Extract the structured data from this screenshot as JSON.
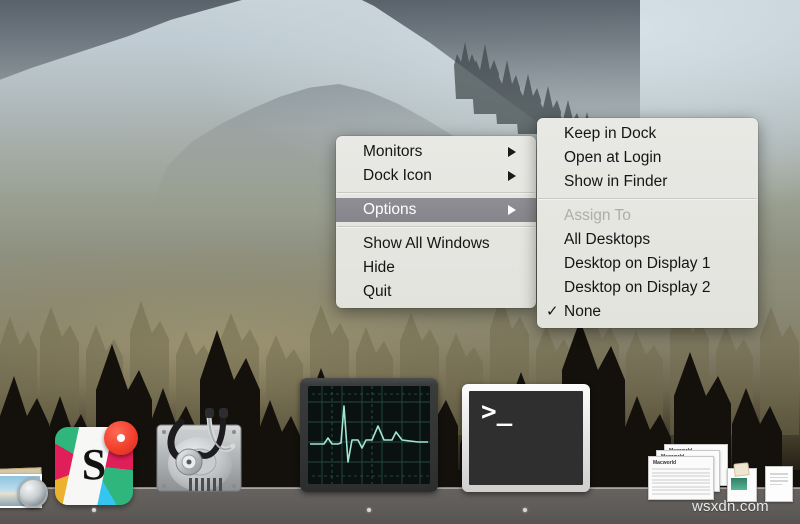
{
  "desktop": {
    "wallpaper_description": "Hazy mountain forest landscape",
    "watermark": "wsxdn.com"
  },
  "context_menu": {
    "name": "dock-context-menu",
    "items": [
      {
        "label": "Monitors",
        "type": "submenu",
        "state": "normal"
      },
      {
        "label": "Dock Icon",
        "type": "submenu",
        "state": "normal"
      },
      {
        "label": "",
        "type": "separator",
        "state": "normal"
      },
      {
        "label": "Options",
        "type": "submenu",
        "state": "selected"
      },
      {
        "label": "",
        "type": "separator",
        "state": "normal"
      },
      {
        "label": "Show All Windows",
        "type": "item",
        "state": "normal"
      },
      {
        "label": "Hide",
        "type": "item",
        "state": "normal"
      },
      {
        "label": "Quit",
        "type": "item",
        "state": "normal"
      }
    ]
  },
  "options_submenu": {
    "name": "options-submenu",
    "items": [
      {
        "label": "Keep in Dock",
        "type": "item",
        "state": "normal",
        "checked": false
      },
      {
        "label": "Open at Login",
        "type": "item",
        "state": "normal",
        "checked": false
      },
      {
        "label": "Show in Finder",
        "type": "item",
        "state": "normal",
        "checked": false
      },
      {
        "label": "",
        "type": "separator",
        "state": "normal",
        "checked": false
      },
      {
        "label": "Assign To",
        "type": "header",
        "state": "disabled",
        "checked": false
      },
      {
        "label": "All Desktops",
        "type": "item",
        "state": "normal",
        "checked": false
      },
      {
        "label": "Desktop on Display 1",
        "type": "item",
        "state": "normal",
        "checked": false
      },
      {
        "label": "Desktop on Display 2",
        "type": "item",
        "state": "normal",
        "checked": false
      },
      {
        "label": "None",
        "type": "item",
        "state": "normal",
        "checked": true
      }
    ],
    "checkmark_glyph": "✓"
  },
  "dock": {
    "items": [
      {
        "name": "preview-icon",
        "label": "Preview",
        "running": false
      },
      {
        "name": "slack-icon",
        "label": "Slack",
        "running": true,
        "badge": "recording"
      },
      {
        "name": "disk-utility-icon",
        "label": "Disk Utility",
        "running": false
      },
      {
        "name": "activity-monitor-icon",
        "label": "Activity Monitor",
        "running": true
      },
      {
        "name": "terminal-icon",
        "label": "Terminal",
        "running": true,
        "prompt": ">_"
      },
      {
        "name": "documents-stack-icon",
        "label": "Documents",
        "running": false
      },
      {
        "name": "package-file-icon",
        "label": "Package",
        "running": false
      },
      {
        "name": "pdf-file-icon",
        "label": "PDF",
        "running": false
      }
    ],
    "document_preview_title": "Macworld"
  },
  "colors": {
    "menu_background": "#e8e8e4",
    "menu_highlight": "#8e8e94",
    "menu_text": "#151515",
    "menu_disabled_text": "#aeaea9",
    "dock_shelf": "#5e5b58",
    "slack_red": "#e01e5a",
    "slack_green": "#2eb67d",
    "slack_blue": "#36c5f0",
    "slack_yellow": "#ecb22e",
    "record_badge": "#f0402c",
    "oscilloscope_trace": "#7fd8c4"
  }
}
